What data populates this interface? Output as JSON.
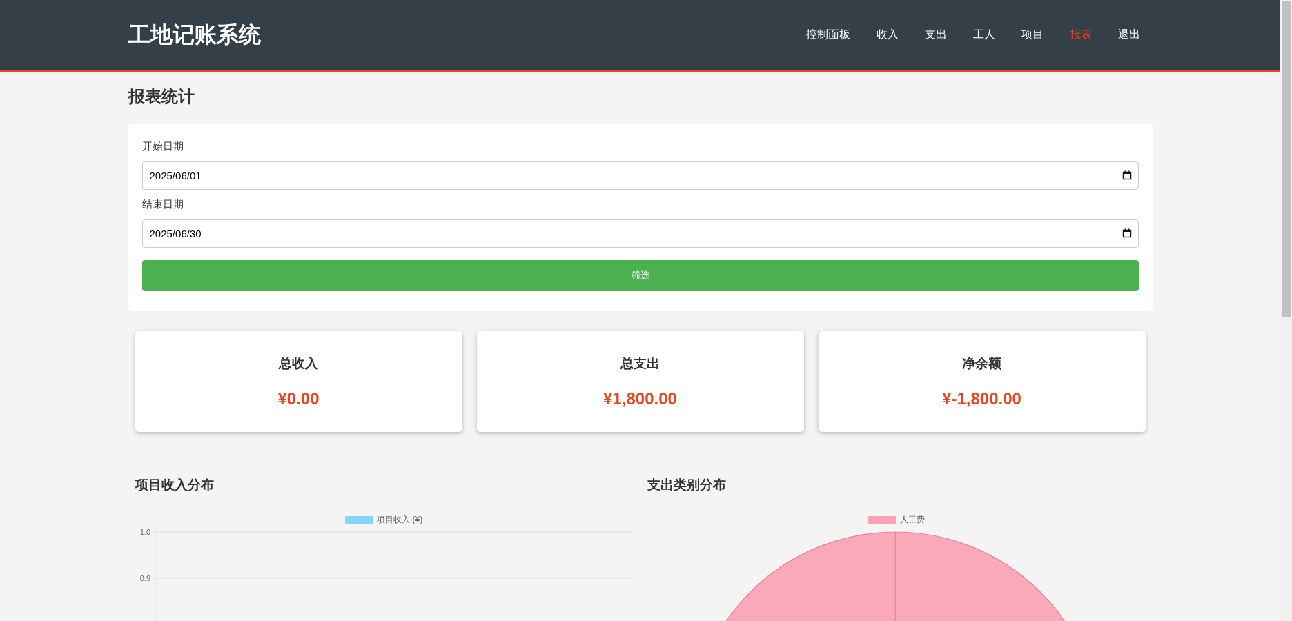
{
  "header": {
    "logo": "工地记账系统",
    "nav": [
      {
        "label": "控制面板",
        "selected": false
      },
      {
        "label": "收入",
        "selected": false
      },
      {
        "label": "支出",
        "selected": false
      },
      {
        "label": "工人",
        "selected": false
      },
      {
        "label": "项目",
        "selected": false
      },
      {
        "label": "报表",
        "selected": true
      },
      {
        "label": "退出",
        "selected": false
      }
    ]
  },
  "page_title": "报表统计",
  "filter": {
    "fields": [
      {
        "label": "开始日期",
        "value": "2025/06/01"
      },
      {
        "label": "结束日期",
        "value": "2025/06/30"
      }
    ],
    "button": "筛选"
  },
  "summary_cards": [
    {
      "title": "总收入",
      "amount": "¥0.00"
    },
    {
      "title": "总支出",
      "amount": "¥1,800.00"
    },
    {
      "title": "净余额",
      "amount": "¥-1,800.00"
    }
  ],
  "charts": [
    {
      "title": "项目收入分布",
      "chart_data": {
        "type": "bar",
        "series": [
          {
            "name": "项目收入 (¥)",
            "color": "#9ad0f5"
          }
        ],
        "ylim": [
          0,
          1
        ],
        "yticks": [
          {
            "value": 1,
            "label": "1.0"
          },
          {
            "value": 0.9,
            "label": "0.9"
          }
        ]
      }
    },
    {
      "title": "支出类别分布",
      "chart_data": {
        "type": "pie",
        "categories": [
          "人工费"
        ],
        "series": [
          {
            "color": "#faa9ba",
            "values": [
              100
            ]
          }
        ]
      }
    }
  ]
}
